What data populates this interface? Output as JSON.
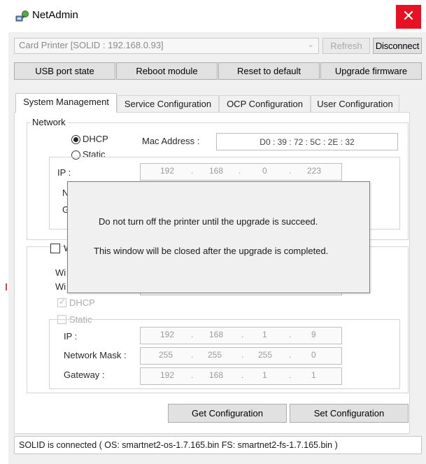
{
  "window": {
    "title": "NetAdmin",
    "close_symbol": "✕",
    "icon_name": "network-admin-icon"
  },
  "toolbar": {
    "device_select": "Card Printer  [SOLID : 192.168.0.93]",
    "refresh_label": "Refresh",
    "disconnect_label": "Disconnect",
    "usb_state_label": "USB port state",
    "reboot_label": "Reboot module",
    "reset_label": "Reset to default",
    "upgrade_label": "Upgrade firmware"
  },
  "tabs": [
    {
      "label": "System Management",
      "active": true
    },
    {
      "label": "Service Configuration",
      "active": false
    },
    {
      "label": "OCP Configuration",
      "active": false
    },
    {
      "label": "User Configuration",
      "active": false
    }
  ],
  "network": {
    "group_label": "Network",
    "dhcp_label": "DHCP",
    "static_label": "Static",
    "dhcp_selected": true,
    "mac_label": "Mac Address :",
    "mac_value": "D0 : 39 : 72 : 5C : 2E : 32",
    "ip_label": "IP :",
    "ip": [
      "192",
      "168",
      "0",
      "223"
    ],
    "mask_label_partial": "N",
    "gateway_label_partial": "G"
  },
  "wireless": {
    "check_label_partial": "W",
    "row1_label_partial": "Wi",
    "row2_label_partial": "Wi",
    "dhcp_label": "DHCP",
    "static_label": "Static",
    "ip_label": "IP :",
    "mask_label": "Network Mask :",
    "gateway_label": "Gateway :",
    "ip": [
      "192",
      "168",
      "1",
      "9"
    ],
    "mask": [
      "255",
      "255",
      "255",
      "0"
    ],
    "gateway": [
      "192",
      "168",
      "1",
      "1"
    ]
  },
  "actions": {
    "get_label": "Get Configuration",
    "set_label": "Set Configuration"
  },
  "modal": {
    "line1": "Do not turn off the printer until the upgrade is succeed.",
    "line2": "This window will be closed after the upgrade is completed."
  },
  "status": {
    "text": "SOLID is connected ( OS: smartnet2-os-1.7.165.bin  FS: smartnet2-fs-1.7.165.bin )"
  },
  "colors": {
    "close_button": "#e81123",
    "window_background": "#f0f0f0",
    "panel_background": "#ffffff"
  }
}
